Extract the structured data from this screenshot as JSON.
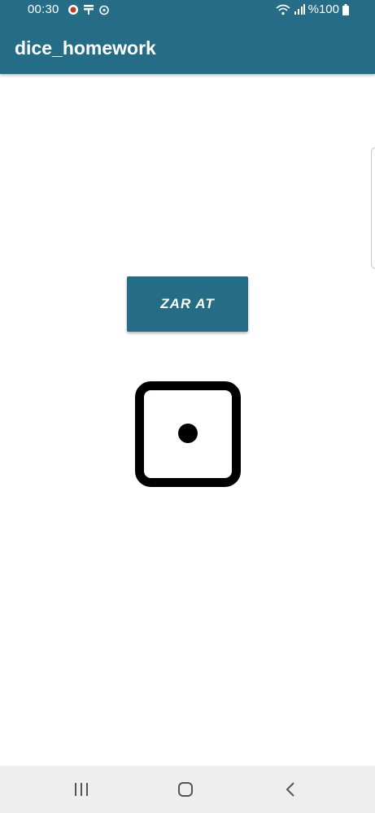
{
  "status_bar": {
    "time": "00:30",
    "battery_text": "%100",
    "icons": [
      "app-notification-icon",
      "usb-icon",
      "alarm-icon",
      "wifi-icon",
      "signal-icon",
      "battery-icon"
    ]
  },
  "app_bar": {
    "title": "dice_homework",
    "color": "#256d86"
  },
  "main": {
    "roll_button_label": "ZAR AT",
    "dice_face": 1
  },
  "nav_bar": {
    "buttons": [
      "recent-apps-icon",
      "home-icon",
      "back-icon"
    ]
  }
}
